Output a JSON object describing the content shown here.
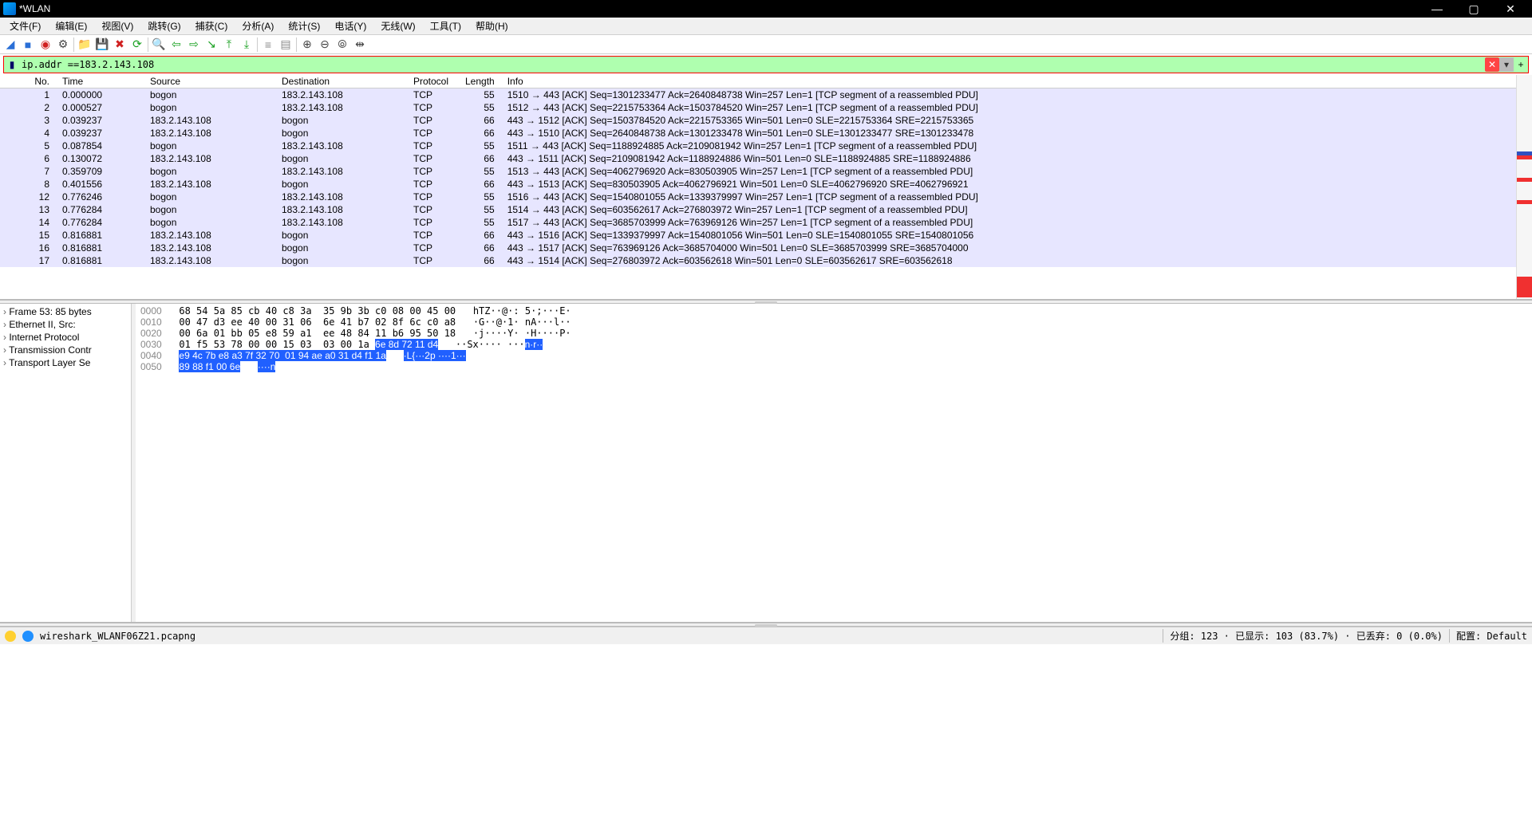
{
  "window": {
    "title": "*WLAN"
  },
  "menus": [
    "文件(F)",
    "编辑(E)",
    "视图(V)",
    "跳转(G)",
    "捕获(C)",
    "分析(A)",
    "统计(S)",
    "电话(Y)",
    "无线(W)",
    "工具(T)",
    "帮助(H)"
  ],
  "filter": {
    "value": "ip.addr ==183.2.143.108"
  },
  "columns": [
    "No.",
    "Time",
    "Source",
    "Destination",
    "Protocol",
    "Length",
    "Info"
  ],
  "packets": [
    {
      "no": "1",
      "time": "0.000000",
      "src": "bogon",
      "dst": "183.2.143.108",
      "proto": "TCP",
      "len": "55",
      "info": "1510 → 443 [ACK] Seq=1301233477 Ack=2640848738 Win=257 Len=1 [TCP segment of a reassembled PDU]"
    },
    {
      "no": "2",
      "time": "0.000527",
      "src": "bogon",
      "dst": "183.2.143.108",
      "proto": "TCP",
      "len": "55",
      "info": "1512 → 443 [ACK] Seq=2215753364 Ack=1503784520 Win=257 Len=1 [TCP segment of a reassembled PDU]"
    },
    {
      "no": "3",
      "time": "0.039237",
      "src": "183.2.143.108",
      "dst": "bogon",
      "proto": "TCP",
      "len": "66",
      "info": "443 → 1512 [ACK] Seq=1503784520 Ack=2215753365 Win=501 Len=0 SLE=2215753364 SRE=2215753365"
    },
    {
      "no": "4",
      "time": "0.039237",
      "src": "183.2.143.108",
      "dst": "bogon",
      "proto": "TCP",
      "len": "66",
      "info": "443 → 1510 [ACK] Seq=2640848738 Ack=1301233478 Win=501 Len=0 SLE=1301233477 SRE=1301233478"
    },
    {
      "no": "5",
      "time": "0.087854",
      "src": "bogon",
      "dst": "183.2.143.108",
      "proto": "TCP",
      "len": "55",
      "info": "1511 → 443 [ACK] Seq=1188924885 Ack=2109081942 Win=257 Len=1 [TCP segment of a reassembled PDU]"
    },
    {
      "no": "6",
      "time": "0.130072",
      "src": "183.2.143.108",
      "dst": "bogon",
      "proto": "TCP",
      "len": "66",
      "info": "443 → 1511 [ACK] Seq=2109081942 Ack=1188924886 Win=501 Len=0 SLE=1188924885 SRE=1188924886"
    },
    {
      "no": "7",
      "time": "0.359709",
      "src": "bogon",
      "dst": "183.2.143.108",
      "proto": "TCP",
      "len": "55",
      "info": "1513 → 443 [ACK] Seq=4062796920 Ack=830503905 Win=257 Len=1 [TCP segment of a reassembled PDU]"
    },
    {
      "no": "8",
      "time": "0.401556",
      "src": "183.2.143.108",
      "dst": "bogon",
      "proto": "TCP",
      "len": "66",
      "info": "443 → 1513 [ACK] Seq=830503905 Ack=4062796921 Win=501 Len=0 SLE=4062796920 SRE=4062796921"
    },
    {
      "no": "12",
      "time": "0.776246",
      "src": "bogon",
      "dst": "183.2.143.108",
      "proto": "TCP",
      "len": "55",
      "info": "1516 → 443 [ACK] Seq=1540801055 Ack=1339379997 Win=257 Len=1 [TCP segment of a reassembled PDU]"
    },
    {
      "no": "13",
      "time": "0.776284",
      "src": "bogon",
      "dst": "183.2.143.108",
      "proto": "TCP",
      "len": "55",
      "info": "1514 → 443 [ACK] Seq=603562617 Ack=276803972 Win=257 Len=1 [TCP segment of a reassembled PDU]"
    },
    {
      "no": "14",
      "time": "0.776284",
      "src": "bogon",
      "dst": "183.2.143.108",
      "proto": "TCP",
      "len": "55",
      "info": "1517 → 443 [ACK] Seq=3685703999 Ack=763969126 Win=257 Len=1 [TCP segment of a reassembled PDU]"
    },
    {
      "no": "15",
      "time": "0.816881",
      "src": "183.2.143.108",
      "dst": "bogon",
      "proto": "TCP",
      "len": "66",
      "info": "443 → 1516 [ACK] Seq=1339379997 Ack=1540801056 Win=501 Len=0 SLE=1540801055 SRE=1540801056"
    },
    {
      "no": "16",
      "time": "0.816881",
      "src": "183.2.143.108",
      "dst": "bogon",
      "proto": "TCP",
      "len": "66",
      "info": "443 → 1517 [ACK] Seq=763969126 Ack=3685704000 Win=501 Len=0 SLE=3685703999 SRE=3685704000"
    },
    {
      "no": "17",
      "time": "0.816881",
      "src": "183.2.143.108",
      "dst": "bogon",
      "proto": "TCP",
      "len": "66",
      "info": "443 → 1514 [ACK] Seq=276803972 Ack=603562618 Win=501 Len=0 SLE=603562617 SRE=603562618"
    }
  ],
  "tree": [
    "Frame 53: 85 bytes",
    "Ethernet II, Src:",
    "Internet Protocol",
    "Transmission Contr",
    "Transport Layer Se"
  ],
  "hex": {
    "rows": [
      {
        "off": "0000",
        "p": "68 54 5a 85 cb 40 c8 3a  35 9b 3b c0 08 00 45 00",
        "s": "",
        "a": "hTZ··@·: 5·;···E·",
        "as": ""
      },
      {
        "off": "0010",
        "p": "00 47 d3 ee 40 00 31 06  6e 41 b7 02 8f 6c c0 a8",
        "s": "",
        "a": "·G··@·1· nA···l··",
        "as": ""
      },
      {
        "off": "0020",
        "p": "00 6a 01 bb 05 e8 59 a1  ee 48 84 11 b6 95 50 18",
        "s": "",
        "a": "·j····Y· ·H····P·",
        "as": ""
      },
      {
        "off": "0030",
        "p": "01 f5 53 78 00 00 15 03  03 00 1a ",
        "s": "6e 8d 72 11 d4",
        "a": "··Sx···· ···",
        "as": "n·r··"
      },
      {
        "off": "0040",
        "p": "",
        "s": "e9 4c 7b e8 a3 7f 32 70  01 94 ae a0 31 d4 f1 1a",
        "a": "",
        "as": "·L{···2p ····1···"
      },
      {
        "off": "0050",
        "p": "",
        "s": "89 88 f1 00 6e",
        "a": "",
        "as": "····n"
      }
    ]
  },
  "status": {
    "file": "wireshark_WLANF06Z21.pcapng",
    "packets": "分组: 123 · 已显示: 103 (83.7%) · 已丢弃: 0 (0.0%)",
    "profile": "配置: Default"
  },
  "toolbar_icons": [
    "fin-icon",
    "folder-open-icon",
    "save-icon",
    "close-x-icon",
    "reload-icon",
    "find-icon",
    "back-icon",
    "forward-icon",
    "goto-icon",
    "first-icon",
    "last-icon",
    "auto-scroll-icon",
    "colorize-icon",
    "zoom-in-icon",
    "zoom-out-icon",
    "zoom-reset-icon",
    "resize-cols-icon"
  ]
}
